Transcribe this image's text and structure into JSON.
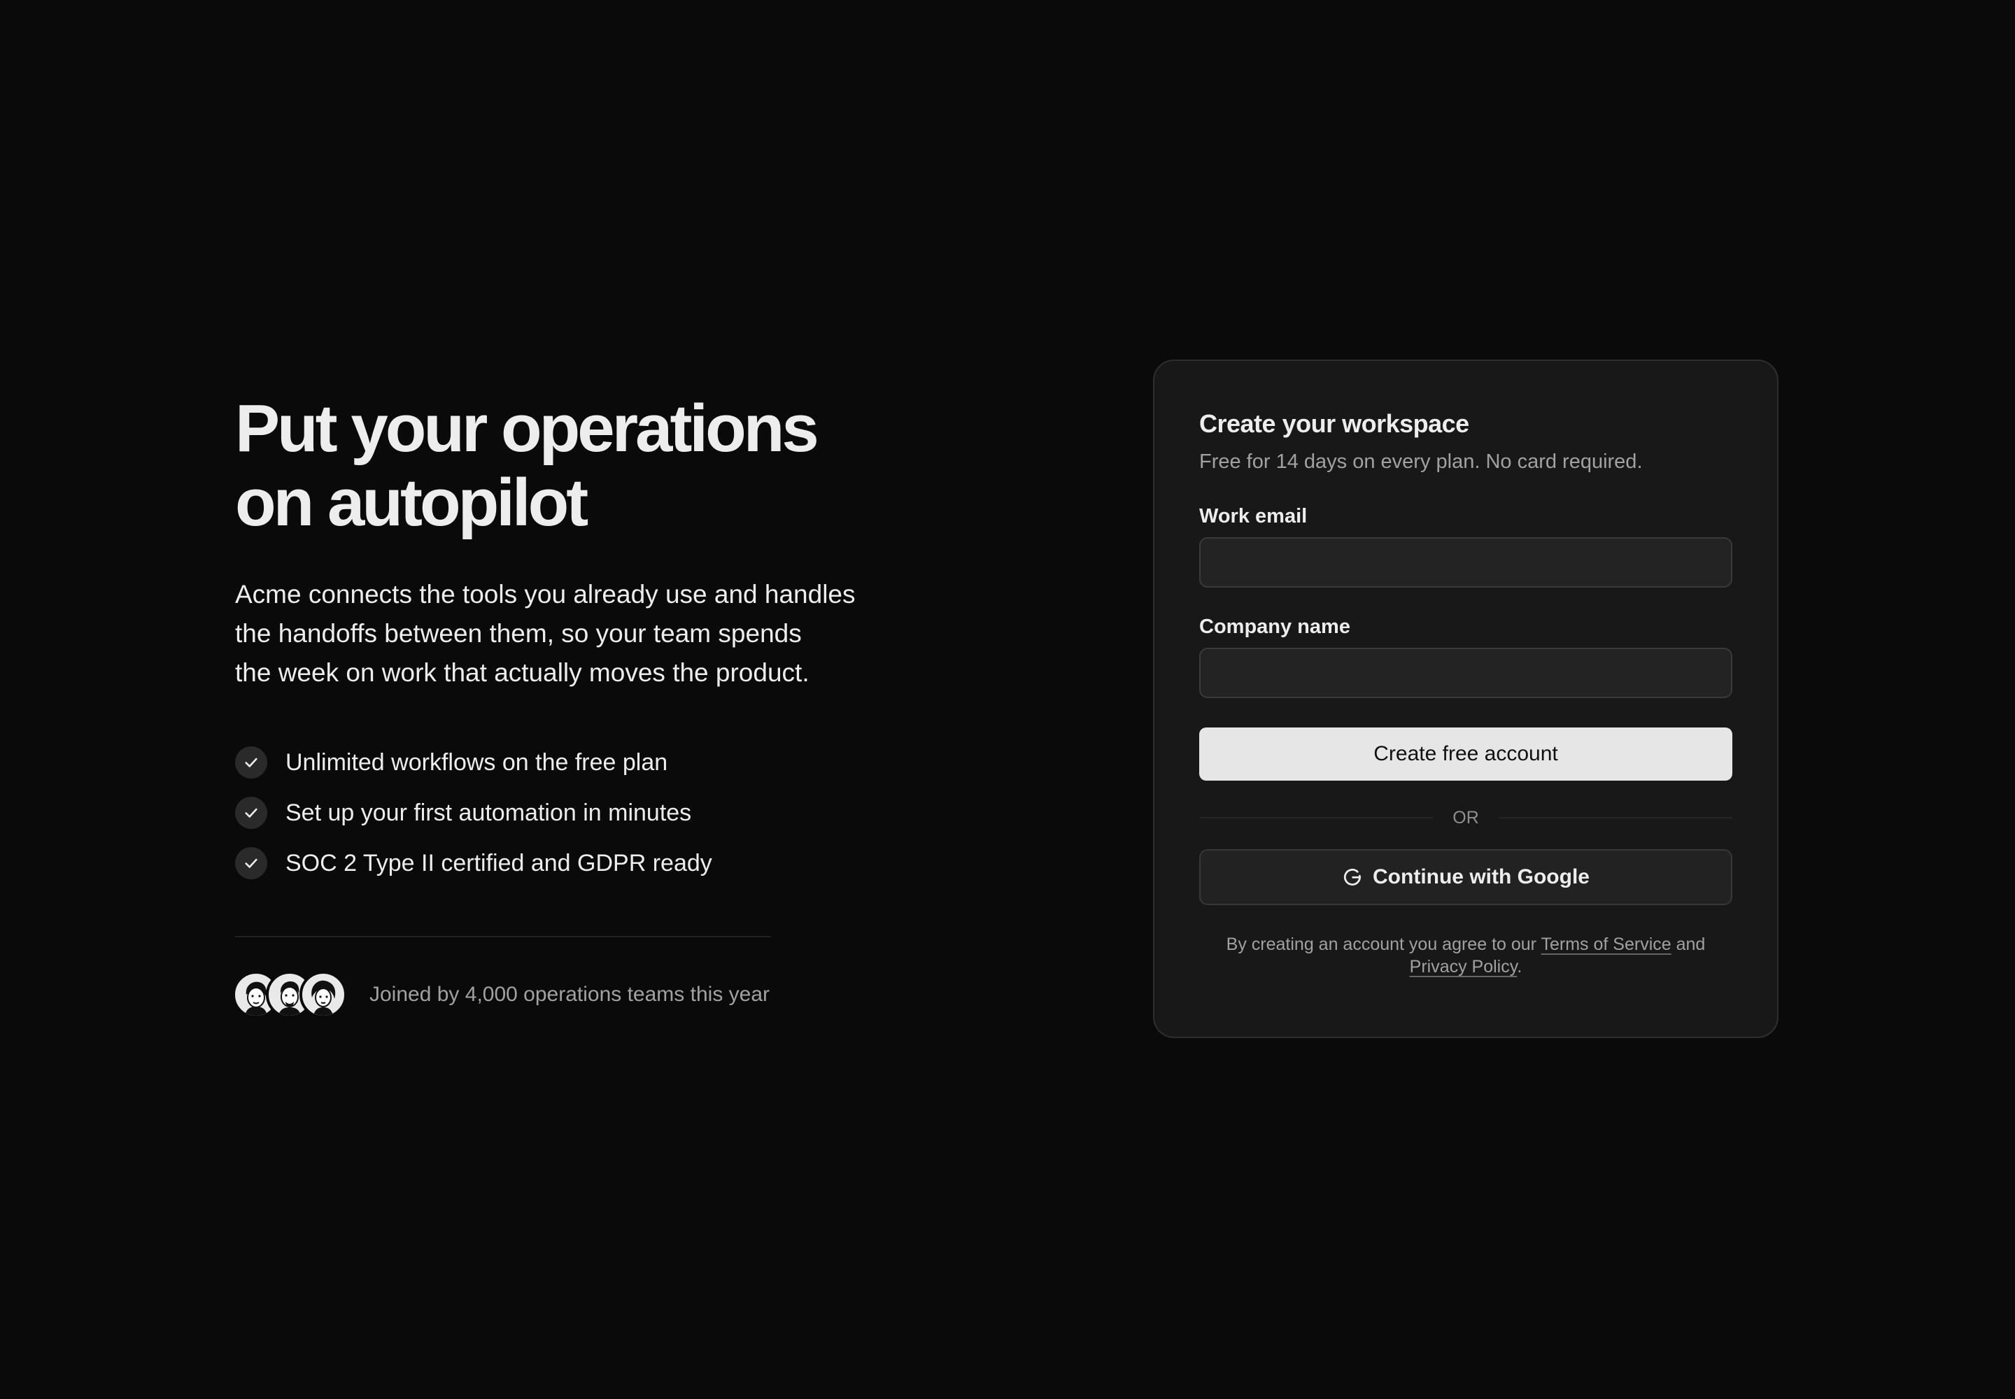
{
  "hero": {
    "title": "Put your operations\non autopilot",
    "description": "Acme connects the tools you already use and handles\nthe handoffs between them, so your team spends\nthe week on work that actually moves the product.",
    "features": [
      {
        "label": "Unlimited workflows on the free plan",
        "icon": "check-icon"
      },
      {
        "label": "Set up your first automation in minutes",
        "icon": "check-icon"
      },
      {
        "label": "SOC 2 Type II certified and GDPR ready",
        "icon": "check-icon"
      }
    ],
    "social_proof": {
      "text": "Joined by 4,000 operations teams this year",
      "avatars": [
        "avatar-illustration-1",
        "avatar-illustration-2",
        "avatar-illustration-3"
      ]
    }
  },
  "signup": {
    "title": "Create your workspace",
    "subtitle": "Free for 14 days on every plan. No card required.",
    "email": {
      "label": "Work email",
      "value": "",
      "placeholder": ""
    },
    "company": {
      "label": "Company name",
      "value": "",
      "placeholder": ""
    },
    "submit_label": "Create free account",
    "divider_label": "OR",
    "google": {
      "label": "Continue with Google",
      "icon": "google-icon"
    },
    "legal": {
      "prefix": "By creating an account you agree to our ",
      "terms_label": "Terms of Service",
      "middle": " and ",
      "privacy_label": "Privacy Policy",
      "suffix": "."
    }
  },
  "colors": {
    "background": "#0a0a0a",
    "card": "#181818",
    "primary_button": "#e6e6e6",
    "text": "#ededed",
    "muted_text": "#a1a1a1"
  }
}
